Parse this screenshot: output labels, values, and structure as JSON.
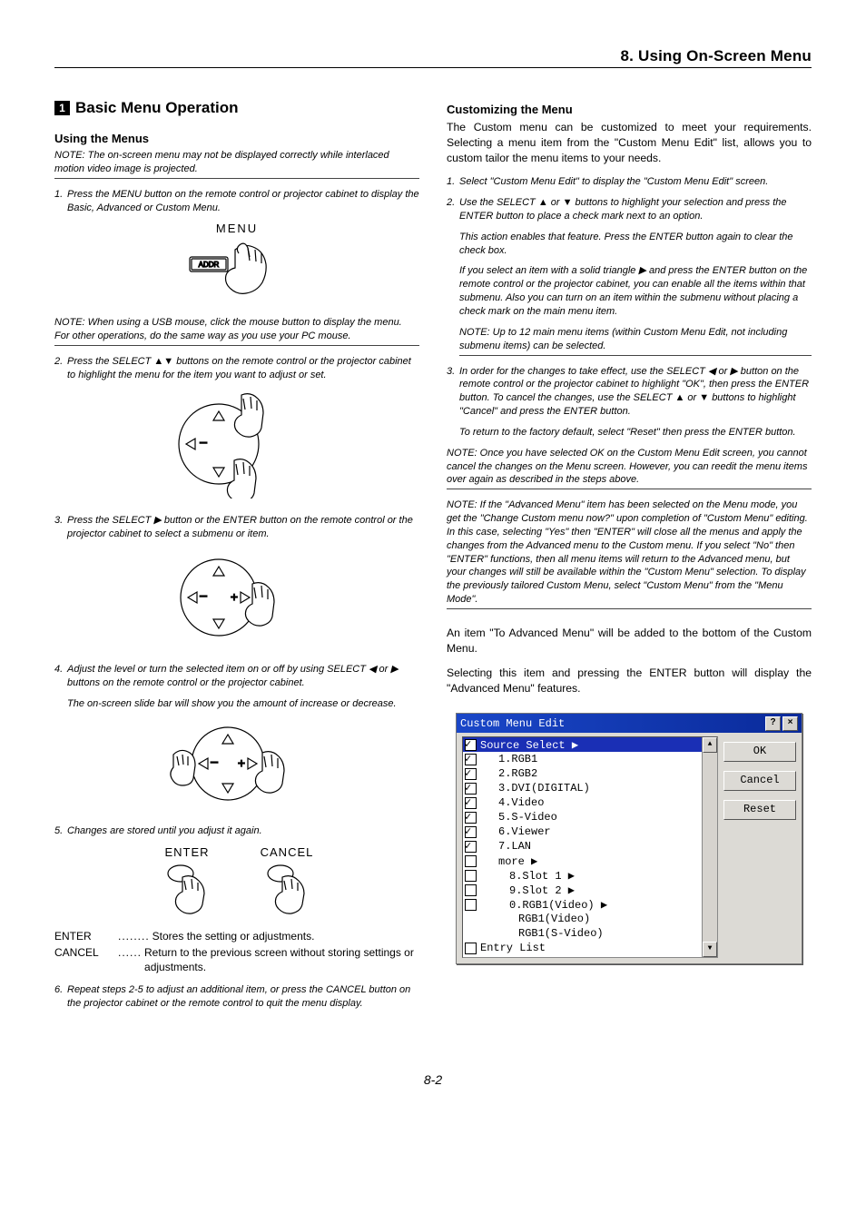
{
  "chapter": "8. Using On-Screen Menu",
  "page_number": "8-2",
  "left": {
    "section_title": "Basic Menu Operation",
    "section_num": "1",
    "using_menus_heading": "Using the Menus",
    "note1": "NOTE: The on-screen menu may not be displayed correctly while interlaced motion video image is projected.",
    "step1": "Press the MENU button on the remote control or projector cabinet to display the Basic, Advanced or Custom Menu.",
    "menu_label": "MENU",
    "addr_label": "ADDR",
    "note2": "NOTE: When using a USB mouse, click the mouse button to display the menu. For other operations, do the same way as you use your PC mouse.",
    "step2": "Press the SELECT ▲▼ buttons on the remote control or the projector cabinet to highlight the menu for the item you want to adjust or set.",
    "step3": "Press the SELECT ▶ button or the ENTER button on the remote control or the projector cabinet to select a submenu or item.",
    "step4": "Adjust the level or turn the selected item on or off by using SELECT ◀ or ▶ buttons on the remote control or the projector cabinet.",
    "step4b": "The on-screen slide bar will show you the amount of increase or decrease.",
    "step5": "Changes are stored until you adjust it again.",
    "enter_label": "ENTER",
    "cancel_label": "CANCEL",
    "dl_enter_term": "ENTER",
    "dl_enter_dots": "........",
    "dl_enter_def": "Stores the setting or adjustments.",
    "dl_cancel_term": "CANCEL",
    "dl_cancel_dots": "......",
    "dl_cancel_def": "Return to the previous screen without storing settings or adjustments.",
    "step6": "Repeat steps 2-5 to adjust an additional item, or press the CANCEL button on the projector cabinet or the remote control to quit the menu display."
  },
  "right": {
    "custom_heading": "Customizing the Menu",
    "intro": "The Custom menu can be customized to meet your requirements. Selecting a menu item from the \"Custom Menu Edit\" list, allows you to custom tailor the menu items to your needs.",
    "step1": "Select \"Custom Menu Edit\" to display the \"Custom Menu Edit\" screen.",
    "step2": "Use the SELECT ▲ or ▼ buttons to highlight your selection and press the ENTER button to place a check mark next to an option.",
    "step2b": "This action enables that feature. Press the ENTER button again to clear the check box.",
    "step2c": "If you select an item with a solid triangle ▶ and press the ENTER button on the remote control or the projector cabinet, you can enable all the items within that submenu. Also you can turn on an item within the submenu without placing a check mark on the main menu item.",
    "note3": "NOTE: Up to 12 main menu items (within Custom Menu Edit, not including submenu items) can be selected.",
    "step3": "In order for the changes to take effect, use the SELECT ◀ or ▶ button on the remote control or the projector cabinet to highlight \"OK\", then press the ENTER button. To cancel the changes, use the SELECT ▲ or ▼ buttons to highlight \"Cancel\" and press the ENTER button.",
    "step3b": "To return to the factory default, select \"Reset\" then press the ENTER button.",
    "note4": "NOTE: Once you have selected OK on the Custom Menu Edit screen, you cannot cancel the changes on the Menu screen. However, you can reedit the menu items over again as described in the steps above.",
    "note5": "NOTE: If the \"Advanced Menu\" item has been selected on the Menu mode, you get the \"Change Custom menu now?\" upon completion of \"Custom Menu\" editing. In this case, selecting \"Yes\" then \"ENTER\" will close all the menus and apply the changes from the Advanced menu to the Custom menu. If you select \"No\" then \"ENTER\" functions, then all menu items will return to the Advanced menu, but your changes will still be available within the \"Custom Menu\" selection. To display the previously tailored Custom Menu, select \"Custom Menu\" from the \"Menu Mode\".",
    "closing1": "An item \"To Advanced Menu\" will be added to the bottom of the Custom Menu.",
    "closing2": "Selecting this item and pressing the ENTER button will display the \"Advanced Menu\" features.",
    "dialog": {
      "title": "Custom Menu Edit",
      "ok": "OK",
      "cancel": "Cancel",
      "reset": "Reset",
      "items": {
        "source": "Source Select ▶",
        "i1": "1.RGB1",
        "i2": "2.RGB2",
        "i3": "3.DVI(DIGITAL)",
        "i4": "4.Video",
        "i5": "5.S-Video",
        "i6": "6.Viewer",
        "i7": "7.LAN",
        "more": "more ▶",
        "s1": "8.Slot 1 ▶",
        "s2": "9.Slot 2 ▶",
        "r1v": "0.RGB1(Video) ▶",
        "rv": "RGB1(Video)",
        "rsv": "RGB1(S-Video)",
        "entry": "Entry List"
      }
    }
  }
}
